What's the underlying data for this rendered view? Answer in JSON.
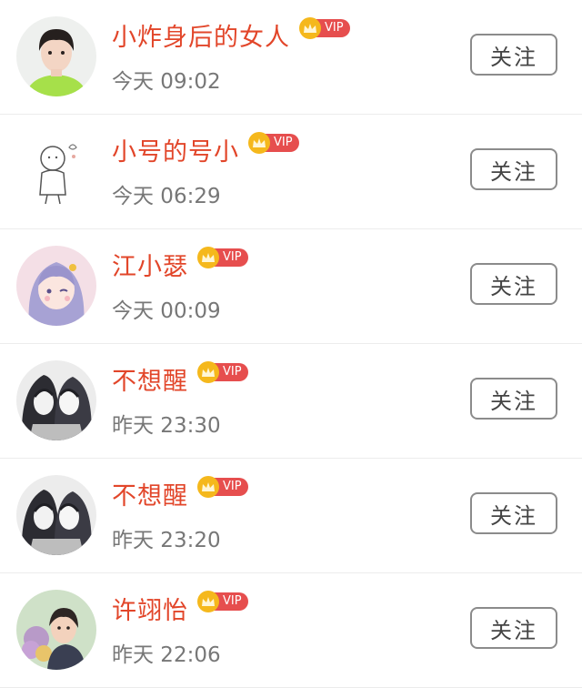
{
  "colors": {
    "name": "#e2462a",
    "vip_badge": "#e64e4e",
    "vip_crown": "#f5b81c",
    "time": "#777777"
  },
  "vip_label": "VIP",
  "users": [
    {
      "name": "小炸身后的女人",
      "time": "今天 09:02",
      "follow_label": "关注",
      "vip": true,
      "avatar": "avatar-boy-green-shirt"
    },
    {
      "name": "小号的号小",
      "time": "今天 06:29",
      "follow_label": "关注",
      "vip": true,
      "avatar": "avatar-sketch-figure"
    },
    {
      "name": "江小瑟",
      "time": "今天 00:09",
      "follow_label": "关注",
      "vip": true,
      "avatar": "avatar-anime-girl"
    },
    {
      "name": "不想醒",
      "time": "昨天 23:30",
      "follow_label": "关注",
      "vip": true,
      "avatar": "avatar-manga-couple"
    },
    {
      "name": "不想醒",
      "time": "昨天 23:20",
      "follow_label": "关注",
      "vip": true,
      "avatar": "avatar-manga-couple"
    },
    {
      "name": "许翊怡",
      "time": "昨天 22:06",
      "follow_label": "关注",
      "vip": true,
      "avatar": "avatar-girl-flowers"
    }
  ]
}
